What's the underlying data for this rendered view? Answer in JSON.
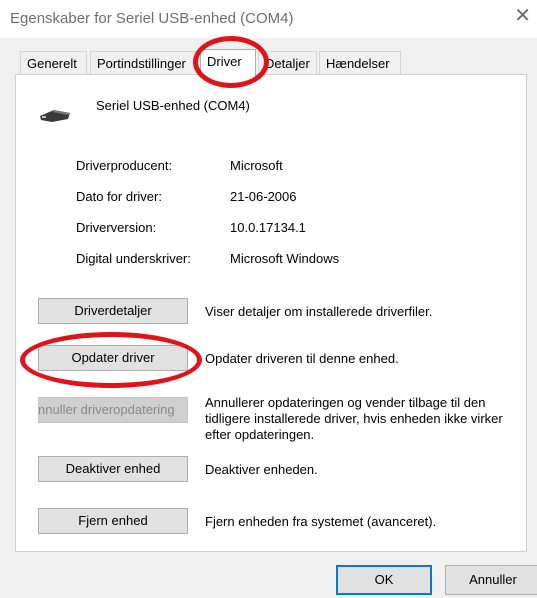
{
  "window": {
    "title": "Egenskaber for Seriel USB-enhed (COM4)",
    "close_icon": "close-icon"
  },
  "tabs": [
    {
      "label": "Generelt"
    },
    {
      "label": "Portindstillinger"
    },
    {
      "label": "Driver",
      "active": true
    },
    {
      "label": "Detaljer"
    },
    {
      "label": "Hændelser"
    }
  ],
  "device": {
    "icon": "usb-serial-device-icon",
    "name": "Seriel USB-enhed (COM4)"
  },
  "info": [
    {
      "label": "Driverproducent:",
      "value": "Microsoft"
    },
    {
      "label": "Dato for driver:",
      "value": "21-06-2006"
    },
    {
      "label": "Driverversion:",
      "value": "10.0.17134.1"
    },
    {
      "label": "Digital underskriver:",
      "value": "Microsoft Windows"
    }
  ],
  "actions": [
    {
      "button": "Driverdetaljer",
      "description": "Viser detaljer om installerede driverfiler."
    },
    {
      "button": "Opdater driver",
      "description": "Opdater driveren til denne enhed."
    },
    {
      "button": "Annuller driveropdatering",
      "description": "Annullerer opdateringen og vender tilbage til den tidligere installerede driver, hvis enheden ikke virker efter opdateringen.",
      "disabled": true
    },
    {
      "button": "Deaktiver enhed",
      "description": "Deaktiver enheden."
    },
    {
      "button": "Fjern enhed",
      "description": "Fjern enheden fra systemet (avanceret)."
    }
  ],
  "footer": {
    "ok": "OK",
    "cancel": "Annuller"
  },
  "annotation_color": "#e0131b"
}
